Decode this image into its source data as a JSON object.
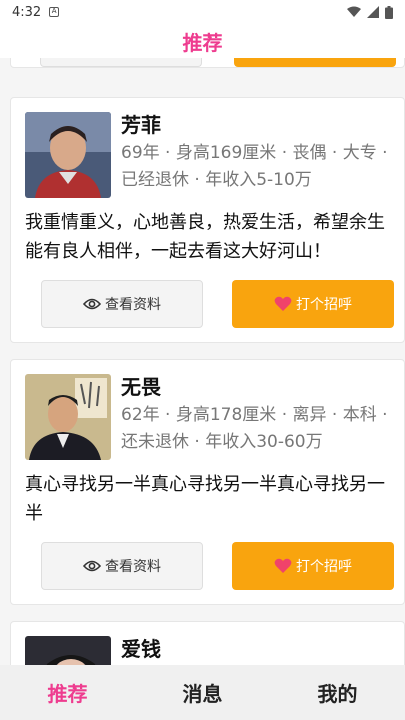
{
  "status_bar": {
    "time": "4:32"
  },
  "header": {
    "title": "推荐"
  },
  "profiles": [
    {
      "name": "芳菲",
      "meta": "69年 · 身高169厘米 · 丧偶 · 大专 · 已经退休 · 年收入5-10万",
      "intro": "我重情重义，心地善良，热爱生活，希望余生能有良人相伴，一起去看这大好河山！",
      "view_label": "查看资料",
      "greet_label": "打个招呼"
    },
    {
      "name": "无畏",
      "meta": "62年 · 身高178厘米 · 离异 · 本科 · 还未退休 · 年收入30-60万",
      "intro": "真心寻找另一半真心寻找另一半真心寻找另一半",
      "view_label": "查看资料",
      "greet_label": "打个招呼"
    },
    {
      "name": "爱钱"
    }
  ],
  "tabs": [
    "推荐",
    "消息",
    "我的"
  ],
  "colors": {
    "accent": "#ee3c8f",
    "greet_button": "#f9a40e"
  }
}
